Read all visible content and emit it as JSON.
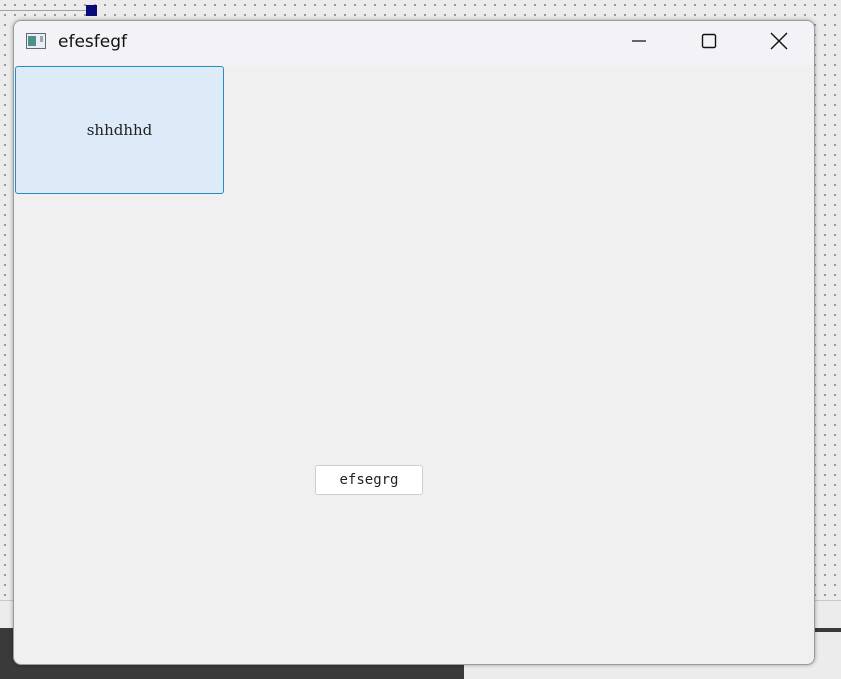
{
  "window": {
    "title": "efesfegf",
    "icon": "app-window-icon",
    "controls": {
      "minimize": "minimize-icon",
      "maximize": "maximize-icon",
      "close": "close-icon"
    }
  },
  "content": {
    "frame_label": "shhdhhd",
    "button_label": "efsegrg"
  },
  "colors": {
    "frame_fill": "#ddeaf7",
    "frame_border": "#2a8ac4",
    "window_bg": "#f0f0f0",
    "titlebar_bg": "#f3f3f7",
    "selection_handle": "#0a0a7a"
  }
}
